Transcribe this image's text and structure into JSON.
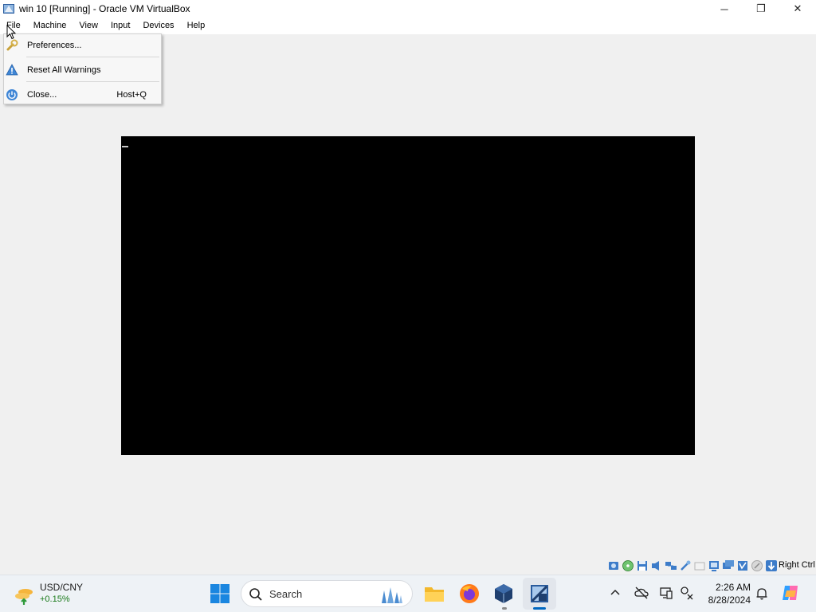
{
  "window": {
    "title": "win 10 [Running] - Oracle VM VirtualBox",
    "controls": {
      "minimize": "─",
      "restore": "❐",
      "close": "✕"
    }
  },
  "menubar": {
    "items": [
      {
        "label": "File"
      },
      {
        "label": "Machine"
      },
      {
        "label": "View"
      },
      {
        "label": "Input"
      },
      {
        "label": "Devices"
      },
      {
        "label": "Help"
      }
    ]
  },
  "file_menu": {
    "items": [
      {
        "label": "Preferences...",
        "icon": "preferences-wrench-icon",
        "shortcut": ""
      },
      {
        "label": "Reset All Warnings",
        "icon": "warning-icon",
        "shortcut": ""
      },
      {
        "label": "Close...",
        "icon": "power-icon",
        "shortcut": "Host+Q"
      }
    ]
  },
  "statusbar": {
    "icons": [
      "hard-disk-icon",
      "optical-drive-icon",
      "floppy-icon",
      "audio-icon",
      "network-icon",
      "usb-icon",
      "shared-folders-icon",
      "display-icon",
      "video-capture-icon",
      "virtualization-icon",
      "mouse-integration-icon",
      "keyboard-icon"
    ],
    "host_key": "Right Ctrl"
  },
  "taskbar": {
    "widget": {
      "name": "USD/CNY",
      "change": "+0.15%"
    },
    "search": {
      "placeholder": "Search"
    },
    "apps": [
      "file-explorer-icon",
      "firefox-icon",
      "virtualbox-icon",
      "virtualbox-vm-icon"
    ],
    "clock": {
      "time": "2:26 AM",
      "date": "8/28/2024"
    }
  },
  "colors": {
    "accent": "#0067c0",
    "guest_screen": "#000000",
    "window_bg": "#f0f0f0"
  }
}
